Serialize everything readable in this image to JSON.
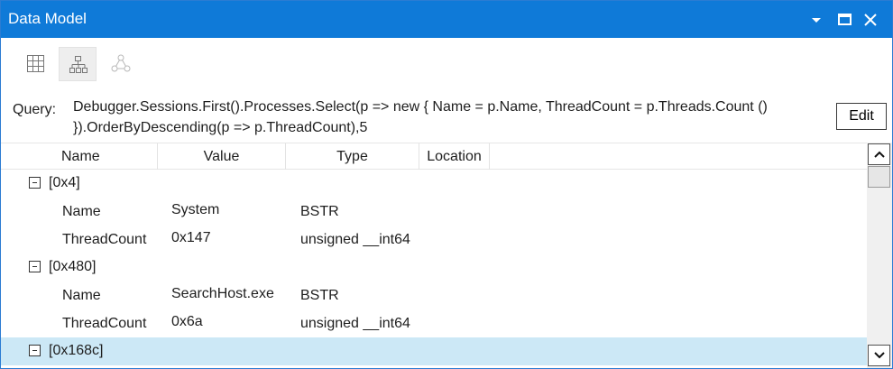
{
  "window": {
    "title": "Data Model"
  },
  "toolbar": {
    "icons": [
      "grid-view-icon",
      "hierarchy-view-icon",
      "graph-view-icon"
    ]
  },
  "query": {
    "label": "Query:",
    "text": "Debugger.Sessions.First().Processes.Select(p => new { Name = p.Name, ThreadCount = p.Threads.Count () }).OrderByDescending(p => p.ThreadCount),5",
    "edit_label": "Edit"
  },
  "columns": {
    "name": "Name",
    "value": "Value",
    "type": "Type",
    "location": "Location"
  },
  "groups": [
    {
      "label": "[0x4]",
      "props": [
        {
          "name": "Name",
          "value": "System",
          "type": "BSTR"
        },
        {
          "name": "ThreadCount",
          "value": "0x147",
          "type": "unsigned __int64"
        }
      ]
    },
    {
      "label": "[0x480]",
      "props": [
        {
          "name": "Name",
          "value": "SearchHost.exe",
          "type": "BSTR"
        },
        {
          "name": "ThreadCount",
          "value": "0x6a",
          "type": "unsigned __int64"
        }
      ]
    },
    {
      "label": "[0x168c]",
      "selected": true
    }
  ],
  "colors": {
    "titlebar": "#0f7ad8",
    "selected_row": "#cce8f6"
  }
}
